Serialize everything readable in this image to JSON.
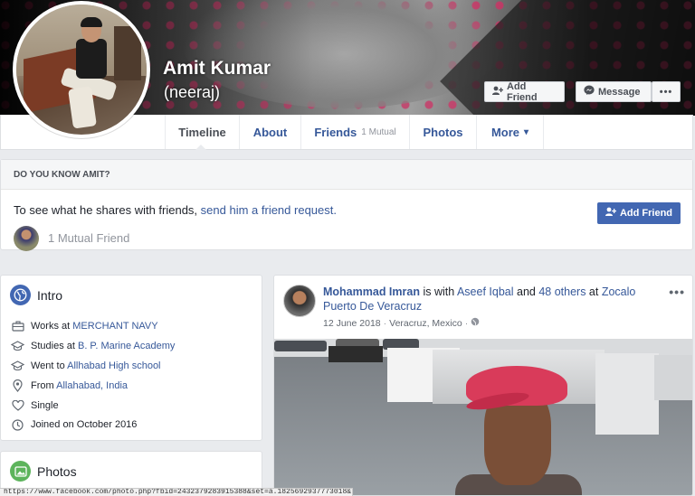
{
  "profile": {
    "name": "Amit Kumar",
    "nickname": "(neeraj)",
    "buttons": {
      "add_friend": "Add Friend",
      "message": "Message",
      "more": "•••"
    }
  },
  "nav": {
    "tabs": [
      {
        "label": "Timeline",
        "active": true
      },
      {
        "label": "About"
      },
      {
        "label": "Friends",
        "sub": "1 Mutual"
      },
      {
        "label": "Photos"
      },
      {
        "label": "More",
        "caret": "▾"
      }
    ]
  },
  "know": {
    "header": "DO YOU KNOW AMIT?",
    "line_prefix": "To see what he shares with friends, ",
    "line_link": "send him a friend request.",
    "mutual": "1 Mutual Friend",
    "button": "Add Friend"
  },
  "intro": {
    "title": "Intro",
    "rows": [
      {
        "icon": "briefcase-icon",
        "prefix": "Works at ",
        "link": "MERCHANT NAVY"
      },
      {
        "icon": "graduation-cap-icon",
        "prefix": "Studies at ",
        "link": "B. P. Marine Academy"
      },
      {
        "icon": "graduation-cap-icon",
        "prefix": "Went to ",
        "link": "Allhabad High school"
      },
      {
        "icon": "location-pin-icon",
        "prefix": "From ",
        "link": "Allahabad, India"
      },
      {
        "icon": "heart-icon",
        "prefix": "Single",
        "link": ""
      },
      {
        "icon": "clock-icon",
        "prefix": "Joined on October 2016",
        "link": ""
      }
    ]
  },
  "photos": {
    "title": "Photos"
  },
  "post": {
    "author": "Mohammad Imran",
    "with_text": " is with ",
    "tagged": "Aseef Iqbal",
    "and_text": " and ",
    "others": "48 others",
    "at_text": " at ",
    "place": "Zocalo Puerto De Veracruz",
    "date": "12 June 2018",
    "location": "Veracruz, Mexico",
    "menu": "•••"
  },
  "status_url": "https://www.facebook.com/photo.php?fbid=2432379283915388&set=a.1825692937773018&type=3"
}
